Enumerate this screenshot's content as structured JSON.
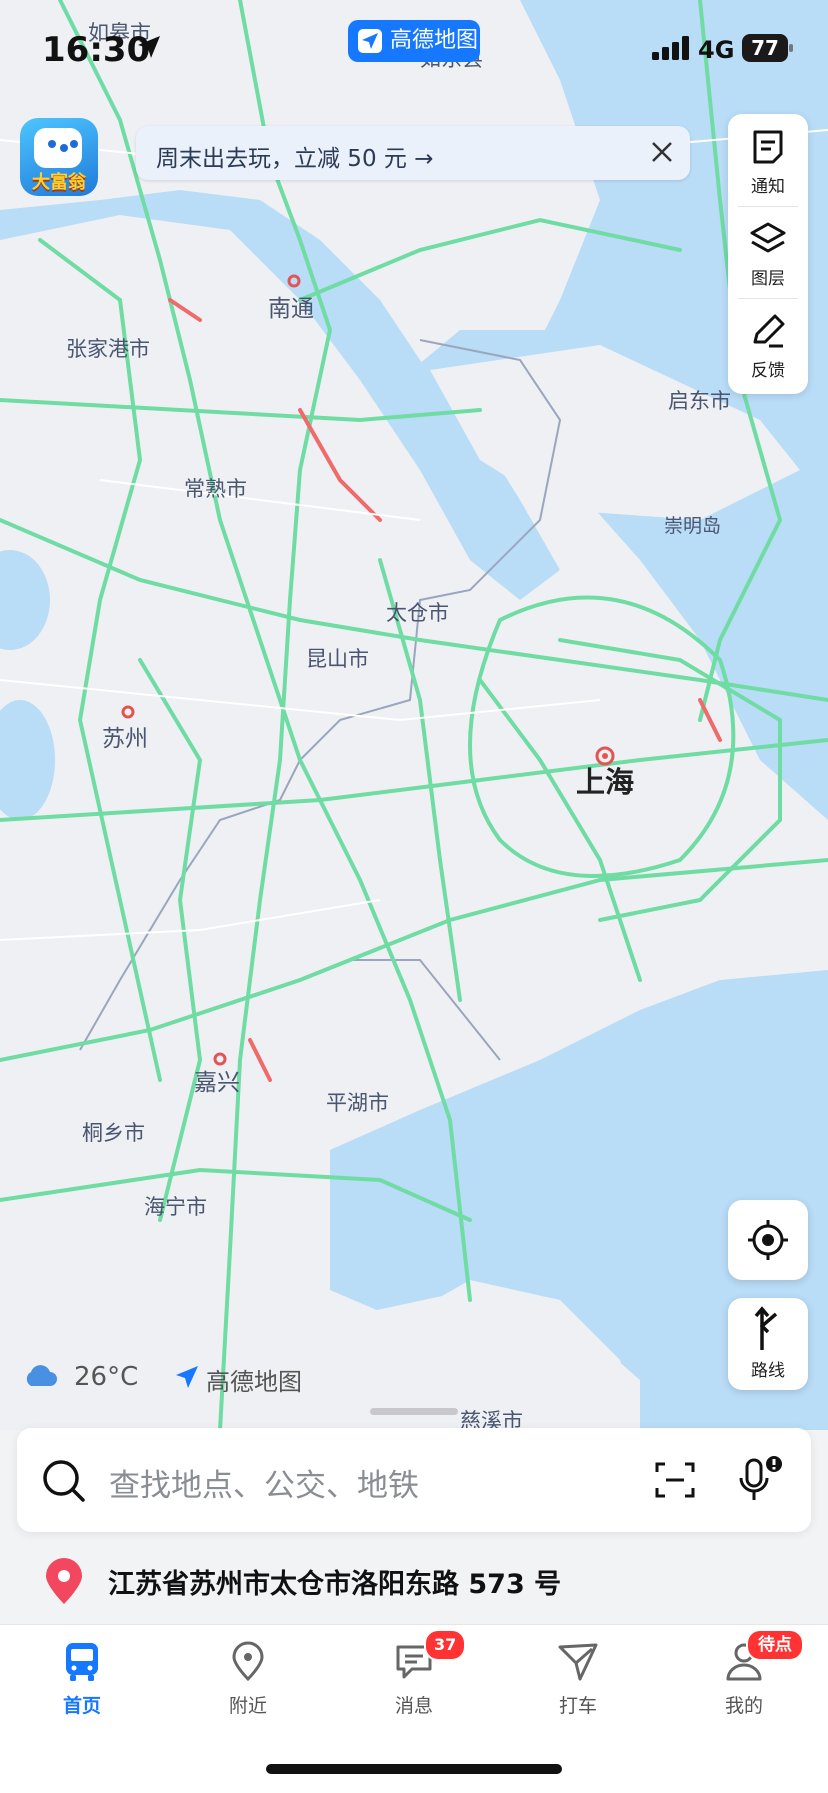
{
  "status_bar": {
    "time": "16:30",
    "network": "4G",
    "battery": "77"
  },
  "app_badge": {
    "label": "高德地图"
  },
  "promo": {
    "game_label": "大富翁",
    "banner_text": "周末出去玩，立减 50 元 →"
  },
  "side_tools": [
    {
      "label": "通知"
    },
    {
      "label": "图层"
    },
    {
      "label": "反馈"
    }
  ],
  "map": {
    "cities": [
      "如皋市",
      "如东县",
      "南通",
      "张家港市",
      "启东市",
      "常熟市",
      "崇明岛",
      "太仓市",
      "昆山市",
      "苏州",
      "上海",
      "嘉兴",
      "平湖市",
      "桐乡市",
      "海宁市",
      "慈溪市"
    ],
    "route_label": "路线"
  },
  "weather": {
    "temp": "26°C",
    "brand": "高德地图"
  },
  "search": {
    "placeholder": "查找地点、公交、地铁"
  },
  "address": {
    "text": "江苏省苏州市太仓市洛阳东路 573 号"
  },
  "tabs": [
    {
      "label": "首页"
    },
    {
      "label": "附近"
    },
    {
      "label": "消息",
      "badge": "37"
    },
    {
      "label": "打车"
    },
    {
      "label": "我的",
      "badge": "待点亮"
    }
  ]
}
